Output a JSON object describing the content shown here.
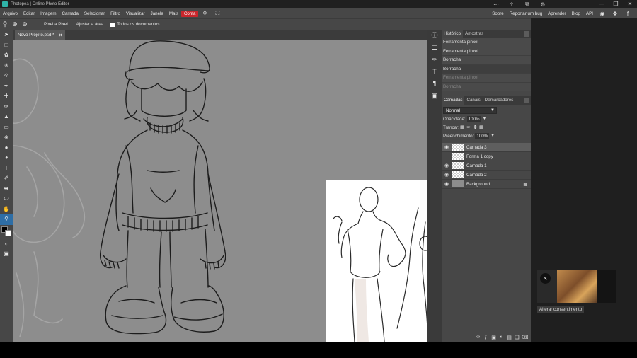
{
  "window": {
    "title": "Photopea | Online Photo Editor",
    "controls": [
      "—",
      "❐",
      "✕"
    ],
    "top_icons": [
      "⋯",
      "⇧",
      "⧉",
      "⚙"
    ]
  },
  "menu": {
    "items": [
      "Arquivo",
      "Editar",
      "Imagem",
      "Camada",
      "Selecionar",
      "Filtro",
      "Visualizar",
      "Janela",
      "Mais"
    ],
    "account": "Conta",
    "right_items": [
      "Sobre",
      "Reportar um bug",
      "Aprender",
      "Blog",
      "API"
    ]
  },
  "options": {
    "pixel_button": "Pixel a Pixel",
    "fit_button": "Ajustar a área",
    "all_docs_label": "Todos os documentos"
  },
  "document": {
    "tab_name": "Novo Projeto.psd *",
    "close": "✕"
  },
  "history": {
    "tabs": [
      "Histórico",
      "Amostras"
    ],
    "items": [
      {
        "label": "Ferramenta pincel",
        "state": "normal"
      },
      {
        "label": "Ferramenta pincel",
        "state": "normal"
      },
      {
        "label": "Borracha",
        "state": "normal"
      },
      {
        "label": "Borracha",
        "state": "selected"
      },
      {
        "label": "Ferramenta pincel",
        "state": "dim"
      },
      {
        "label": "Borracha",
        "state": "dim"
      }
    ]
  },
  "layers": {
    "tabs": [
      "Camadas",
      "Canais",
      "Demarcadores"
    ],
    "blend_mode": "Normal",
    "opacity_label": "Opacidade:",
    "opacity_value": "100%",
    "lock_label": "Trancar:",
    "fill_label": "Preenchimento:",
    "fill_value": "100%",
    "items": [
      {
        "name": "Camada 3",
        "visible": true,
        "selected": true
      },
      {
        "name": "Forma 1 copy",
        "visible": false,
        "selected": false
      },
      {
        "name": "Camada 1",
        "visible": true,
        "selected": false
      },
      {
        "name": "Camada 2",
        "visible": true,
        "selected": false
      },
      {
        "name": "Background",
        "visible": true,
        "selected": false,
        "locked": true
      }
    ]
  },
  "ad": {
    "consent_button": "Alterar consentimento"
  },
  "colors": {
    "accent": "#2e6ea6",
    "account": "#c9262c",
    "canvas": "#8d8d8d"
  }
}
